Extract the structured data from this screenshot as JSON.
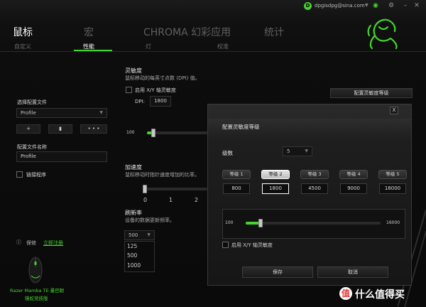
{
  "titlebar": {
    "user_initial": "D",
    "user_email": "dpgisdpg@sina.com",
    "icons": [
      "user-caret-icon",
      "status-icon",
      "settings-icon",
      "minimize-icon",
      "close-icon"
    ]
  },
  "nav": {
    "items": [
      "鼠标",
      "宏",
      "CHROMA 幻彩应用",
      "统计"
    ],
    "active": "鼠标",
    "subitems": [
      "自定义",
      "性能",
      "灯",
      "校准"
    ],
    "active_sub": "性能",
    "accent_color": "#44d62c"
  },
  "left": {
    "profile_section_label": "选择配置文件",
    "profile_select_value": "Profile",
    "buttons": [
      "+",
      "",
      "• • •"
    ],
    "profile_name_label": "配置文件名称",
    "profile_name_value": "Profile",
    "link_program_label": "链接程序",
    "footer_text": "保修",
    "footer_link": "立即注册",
    "device_name": "Razer Mamba TE 曼巴眼",
    "device_sub": "镜蛇竞技版"
  },
  "sensitivity": {
    "title": "灵敏度",
    "desc": "鼠标移动的每英寸点数 (DPI) 值。",
    "xy_label": "启用 X/Y 轴灵敏度",
    "dpi_label": "DPI:",
    "dpi_value": "1800",
    "stage_button_label": "配置灵敏度等级",
    "slider_min_label": "100",
    "slider_fraction": 0.11
  },
  "acceleration": {
    "title": "加速度",
    "desc": "鼠标移动时指针速度增加的比率。",
    "ticks": [
      "0",
      "1",
      "2"
    ],
    "slider_fraction": 0
  },
  "polling": {
    "title": "刷新率",
    "desc": "设备的数据更新频率。",
    "selected": "500",
    "options": [
      "125",
      "500",
      "1000"
    ]
  },
  "modal": {
    "close_label": "X",
    "title": "配置灵敏度等级",
    "levels_label": "级数",
    "levels_value": "5",
    "stages": [
      {
        "label": "等级 1",
        "value": "800",
        "active": false
      },
      {
        "label": "等级 2",
        "value": "1800",
        "active": true
      },
      {
        "label": "等级 3",
        "value": "4500",
        "active": false
      },
      {
        "label": "等级 4",
        "value": "9000",
        "active": false
      },
      {
        "label": "等级 5",
        "value": "16000",
        "active": false
      }
    ],
    "slider_min": "100",
    "slider_max": "16000",
    "slider_fraction": 0.11,
    "xy_label": "启用 X/Y 轴灵敏度",
    "save_label": "保存",
    "cancel_label": "取消"
  },
  "watermark": {
    "icon_text": "值",
    "text": "什么值得买"
  }
}
